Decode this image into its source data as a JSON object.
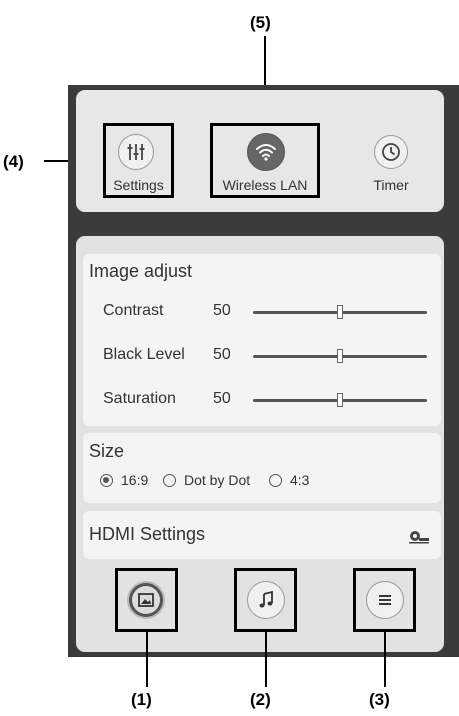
{
  "callouts": {
    "c1": "(1)",
    "c2": "(2)",
    "c3": "(3)",
    "c4": "(4)",
    "c5": "(5)"
  },
  "top_bar": {
    "settings_label": "Settings",
    "wireless_label": "Wireless LAN",
    "timer_label": "Timer"
  },
  "image_adjust": {
    "title": "Image adjust",
    "rows": [
      {
        "label": "Contrast",
        "value": "50",
        "level": 50
      },
      {
        "label": "Black Level",
        "value": "50",
        "level": 50
      },
      {
        "label": "Saturation",
        "value": "50",
        "level": 50
      }
    ]
  },
  "size": {
    "title": "Size",
    "options": [
      {
        "label": "16:9",
        "selected": true
      },
      {
        "label": "Dot by Dot",
        "selected": false
      },
      {
        "label": "4:3",
        "selected": false
      }
    ]
  },
  "hdmi": {
    "title": "HDMI Settings"
  },
  "bottom_icons": [
    "picture-icon",
    "music-note-icon",
    "menu-icon"
  ],
  "colors": {
    "device": "#3b3b3b",
    "panel": "#e2e2e2",
    "active_icon": "#666666"
  }
}
